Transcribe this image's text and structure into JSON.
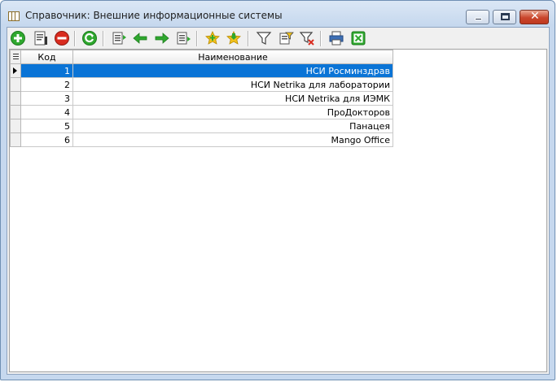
{
  "window": {
    "title": "Справочник: Внешние информационные системы",
    "controls": [
      "minimize-icon",
      "maximize-icon",
      "close-icon"
    ]
  },
  "toolbar": {
    "buttons": [
      {
        "name": "add-button",
        "icon": "green-plus-icon"
      },
      {
        "name": "edit-button",
        "icon": "edit-document-icon"
      },
      {
        "name": "delete-button",
        "icon": "red-minus-icon"
      },
      {
        "name": "refresh-button",
        "icon": "green-refresh-icon"
      },
      {
        "name": "move-first-button",
        "icon": "list-first-icon"
      },
      {
        "name": "move-prev-button",
        "icon": "green-arrow-left-icon"
      },
      {
        "name": "move-next-button",
        "icon": "green-arrow-right-icon"
      },
      {
        "name": "move-last-button",
        "icon": "list-last-icon"
      },
      {
        "name": "add-favorite-button",
        "icon": "star-plus-icon"
      },
      {
        "name": "favorite-down-button",
        "icon": "star-arrow-icon"
      },
      {
        "name": "filter-button",
        "icon": "filter-icon"
      },
      {
        "name": "filter-edit-button",
        "icon": "filter-edit-icon"
      },
      {
        "name": "filter-clear-button",
        "icon": "filter-clear-icon"
      },
      {
        "name": "print-button",
        "icon": "printer-icon"
      },
      {
        "name": "export-excel-button",
        "icon": "excel-icon"
      }
    ]
  },
  "grid": {
    "columns": [
      "Код",
      "Наименование"
    ],
    "rows": [
      {
        "code": "1",
        "name": "НСИ Росминздрав"
      },
      {
        "code": "2",
        "name": "НСИ Netrika для лаборатории"
      },
      {
        "code": "3",
        "name": "НСИ Netrika для ИЭМК"
      },
      {
        "code": "4",
        "name": "ПроДокторов"
      },
      {
        "code": "5",
        "name": "Панацея"
      },
      {
        "code": "6",
        "name": "Mango Office"
      }
    ],
    "selected_row": 0
  },
  "colors": {
    "selection": "#0a74d6",
    "green": "#2fa82f",
    "red": "#d92b1f"
  }
}
